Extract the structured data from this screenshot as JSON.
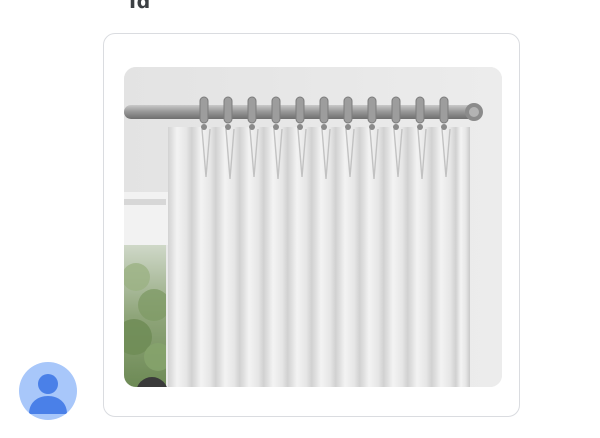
{
  "header": {
    "clipped_title": "Id"
  },
  "card": {
    "image_alt": "",
    "image_icon": "curtain-image"
  },
  "avatar": {
    "icon": "person-icon",
    "color": "#a8c7fa",
    "figure_color": "#4a80e8"
  }
}
